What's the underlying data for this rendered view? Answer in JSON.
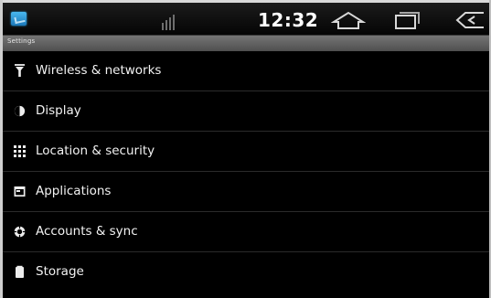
{
  "status_bar": {
    "time": "12:32",
    "notification_icon": "notification-icon",
    "signal_icon": "signal-icon",
    "nav_icons": [
      "home-icon",
      "recent-apps-icon",
      "back-icon"
    ]
  },
  "title_bar": {
    "title": "Settings"
  },
  "settings": {
    "items": [
      {
        "label": "Wireless & networks",
        "icon": "wireless-icon"
      },
      {
        "label": "Display",
        "icon": "display-icon"
      },
      {
        "label": "Location & security",
        "icon": "location-security-icon"
      },
      {
        "label": "Applications",
        "icon": "applications-icon"
      },
      {
        "label": "Accounts & sync",
        "icon": "accounts-sync-icon"
      },
      {
        "label": "Storage",
        "icon": "storage-icon"
      }
    ]
  },
  "colors": {
    "background": "#000000",
    "status_bar": "#0f0f0f",
    "title_bar": "#666666",
    "text": "#f2f2f2",
    "divider": "#2b2b2b",
    "notification_blue": "#1b78b8"
  }
}
